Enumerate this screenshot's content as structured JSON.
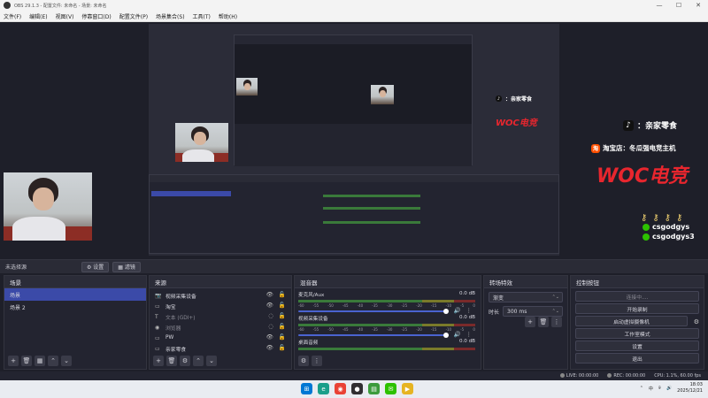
{
  "window": {
    "title": "OBS 29.1.3 - 配置文件: 未命名 - 场景: 未命名",
    "min": "—",
    "max": "☐",
    "close": "✕"
  },
  "menu": [
    "文件(F)",
    "编辑(E)",
    "视图(V)",
    "停靠窗口(D)",
    "配置文件(P)",
    "场景集合(S)",
    "工具(T)",
    "帮助(H)"
  ],
  "overlay": {
    "tiktok_text": "：亲家零食",
    "taobao_label": "淘",
    "taobao_text": "淘宝店：冬瓜强电竞主机",
    "woc_logo": "WOC电竞",
    "wechat_ids": [
      "csgodgys",
      "csgodgys3"
    ]
  },
  "status_row": {
    "scene_label": "未选择源",
    "properties": "⚙ 设置",
    "filters": "▦ 滤镜"
  },
  "scenes": {
    "title": "场景",
    "items": [
      {
        "label": "场景",
        "active": true
      },
      {
        "label": "场景 2",
        "active": false
      }
    ]
  },
  "sources": {
    "title": "来源",
    "items": [
      {
        "icon": "📷",
        "label": "视频采集设备",
        "dim": false
      },
      {
        "icon": "▭",
        "label": "淘宝",
        "dim": false
      },
      {
        "icon": "T",
        "label": "文本 (GDI+)",
        "dim": true
      },
      {
        "icon": "◉",
        "label": "浏览器",
        "dim": true
      },
      {
        "icon": "▭",
        "label": "PW",
        "dim": false
      },
      {
        "icon": "▭",
        "label": "亲家零食",
        "dim": false
      }
    ]
  },
  "mixer": {
    "title": "混音器",
    "channels": [
      {
        "name": "麦克风/Aux",
        "db": "0.0 dB"
      },
      {
        "name": "视频采集设备",
        "db": "0.0 dB"
      },
      {
        "name": "桌面音频",
        "db": "0.0 dB"
      }
    ],
    "scale": [
      "-60",
      "-55",
      "-50",
      "-45",
      "-40",
      "-35",
      "-30",
      "-25",
      "-20",
      "-15",
      "-10",
      "-5",
      "0"
    ]
  },
  "transitions": {
    "title": "转场特效",
    "type": "渐变",
    "duration_label": "时长",
    "duration": "300 ms"
  },
  "controls": {
    "title": "控制按钮",
    "buttons": [
      {
        "label": "连接中....",
        "dim": true
      },
      {
        "label": "开始录制",
        "dim": false
      },
      {
        "label": "启动虚拟摄像机",
        "dim": false
      },
      {
        "label": "工作室模式",
        "dim": false
      },
      {
        "label": "设置",
        "dim": false
      },
      {
        "label": "退出",
        "dim": false
      }
    ]
  },
  "statusbar": {
    "live": "LIVE: 00:00:00",
    "rec": "REC: 00:00:00",
    "cpu": "CPU: 1.1%, 60.00 fps"
  },
  "taskbar": {
    "time": "18:03",
    "date": "2025/12/21",
    "ime": "中"
  },
  "colors": {
    "accent": "#3b4aa8",
    "slider": "#4a63d0",
    "woc_red": "#e8262e",
    "taobao": "#ff5000",
    "wechat": "#2dc100"
  }
}
